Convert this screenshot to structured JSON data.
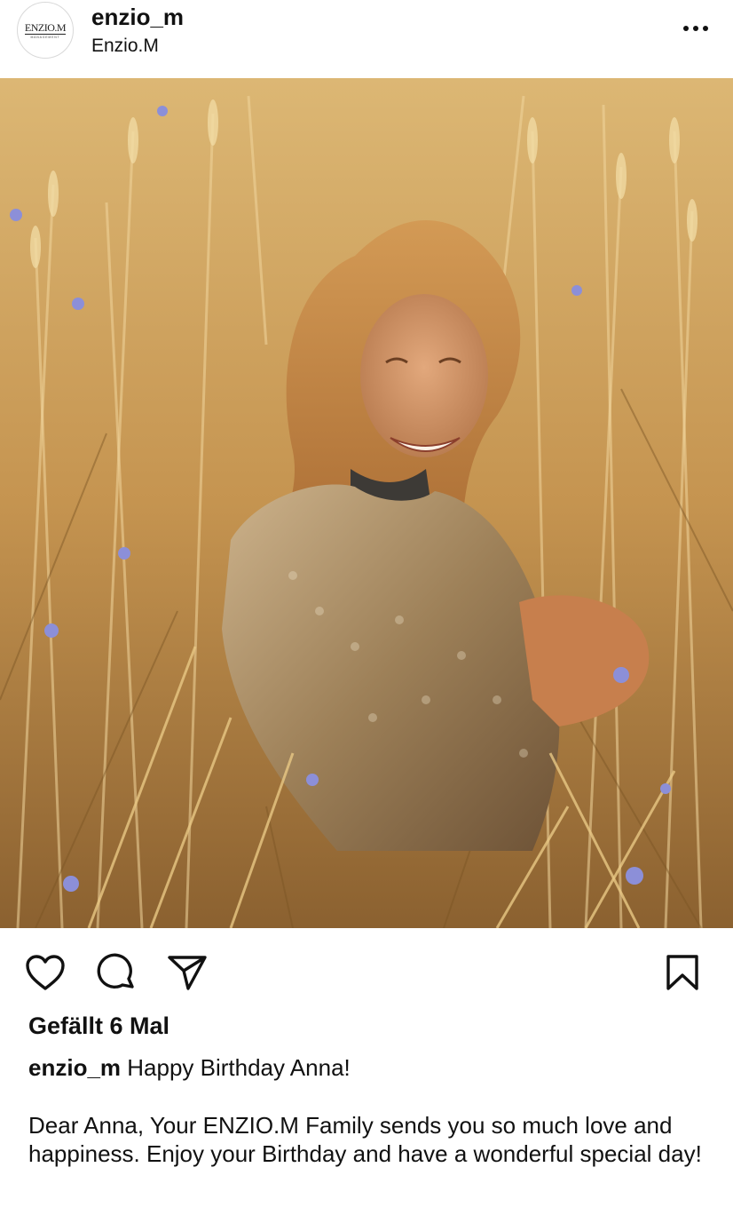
{
  "header": {
    "avatar_logo": "ENZIO.M",
    "avatar_logo_sub": "MANAGEMENT",
    "username": "enzio_m",
    "display_name": "Enzio.M",
    "more_icon": "more-horizontal-icon"
  },
  "photo": {
    "alt": "Frau sitzt lächelnd im Weizenfeld",
    "palette": {
      "wheat": "#d4a95f",
      "shadow": "#6e4b21",
      "hair": "#c88a45",
      "dress": "#b79a72",
      "flower": "#8c8fd8"
    }
  },
  "actions": {
    "like_icon": "heart-icon",
    "comment_icon": "comment-icon",
    "share_icon": "paper-plane-icon",
    "save_icon": "bookmark-icon"
  },
  "likes": "Gefällt 6 Mal",
  "caption": {
    "user": "enzio_m",
    "text": " Happy Birthday Anna!"
  },
  "body": "Dear Anna, Your ENZIO.M Family sends you so much love and happiness. Enjoy your Birthday and have a wonderful special day!"
}
